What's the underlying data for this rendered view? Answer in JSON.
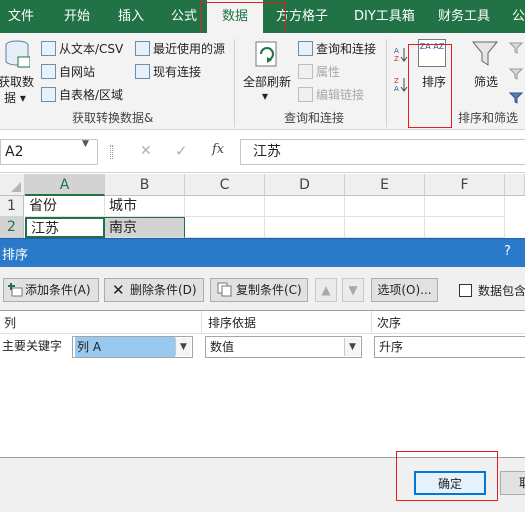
{
  "ribbon_tabs": [
    "文件",
    "开始",
    "插入",
    "公式",
    "数据",
    "方方格子",
    "DIY工具箱",
    "财务工具",
    "公"
  ],
  "active_tab": "数据",
  "ribbon": {
    "get_data": "获取数",
    "get_data_2": "据",
    "from_text_csv": "从文本/CSV",
    "from_web": "自网站",
    "from_table": "自表格/区域",
    "recent_sources": "最近使用的源",
    "existing_connections": "现有连接",
    "group_get_transform": "获取转换数据&",
    "refresh_all": "全部刷新",
    "queries_connections": "查询和连接",
    "properties": "属性",
    "edit_links": "编辑链接",
    "group_queries": "查询和连接",
    "sort_icon_text": "ZA AZ",
    "sort_label": "排序",
    "filter_label": "筛选",
    "group_sort_filter": "排序和筛选"
  },
  "formula_bar": {
    "name_box": "A2",
    "cancel_glyph": "✕",
    "enter_glyph": "✓",
    "fx_glyph": "fx",
    "value": "江苏"
  },
  "grid": {
    "columns": [
      "A",
      "B",
      "C",
      "D",
      "E",
      "F"
    ],
    "rows": [
      {
        "num": "1",
        "cells": [
          "省份",
          "城市"
        ]
      },
      {
        "num": "2",
        "cells": [
          "江苏",
          "南京"
        ]
      }
    ]
  },
  "dialog": {
    "title": "排序",
    "help": "?",
    "add_level": "添加条件(A)",
    "delete_level": "删除条件(D)",
    "copy_level": "复制条件(C)",
    "options": "选项(O)...",
    "has_headers": "数据包含",
    "col_header_column": "列",
    "col_header_sort_on": "排序依据",
    "col_header_order": "次序",
    "primary_key_label": "主要关键字",
    "key_value": "列 A",
    "sort_on_value": "数值",
    "order_value": "升序",
    "ok": "确定",
    "cancel": "取"
  },
  "colors": {
    "excel_green": "#217346",
    "dialog_blue": "#2b79c9",
    "highlight_red": "#e02020",
    "selection_blue": "#99c9ef"
  }
}
